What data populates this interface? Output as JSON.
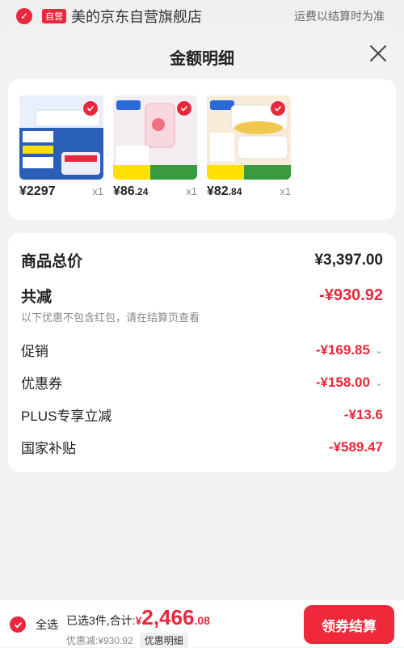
{
  "background": {
    "tag": "自营",
    "store_name": "美的京东自营旗舰店",
    "shipping_note": "运费以结算时为准"
  },
  "sheet": {
    "title": "金额明细"
  },
  "products": [
    {
      "price_int": "¥2297",
      "price_dec": "",
      "qty": "x1"
    },
    {
      "price_int": "¥86",
      "price_dec": ".24",
      "qty": "x1"
    },
    {
      "price_int": "¥82",
      "price_dec": ".84",
      "qty": "x1"
    }
  ],
  "summary": {
    "total_label": "商品总价",
    "total_value": "¥3,397.00",
    "reduce_label": "共减",
    "reduce_value": "-¥930.92",
    "note": "以下优惠不包含红包，请在结算页查看",
    "items": [
      {
        "label": "促销",
        "value": "-¥169.85"
      },
      {
        "label": "优惠券",
        "value": "-¥158.00"
      },
      {
        "label": "PLUS专享立减",
        "value": "-¥13.6"
      },
      {
        "label": "国家补贴",
        "value": "-¥589.47"
      }
    ]
  },
  "bottom": {
    "select_all": "全选",
    "selected_text": "已选3件,合计:",
    "amount_symbol": "¥",
    "amount_int": "2,466",
    "amount_dec": ".08",
    "discount_text": "优惠减:¥930.92",
    "detail_tag": "优惠明细",
    "checkout_label": "领券结算"
  },
  "colors": {
    "accent": "#e8283c",
    "checkout": "#f0283c"
  }
}
